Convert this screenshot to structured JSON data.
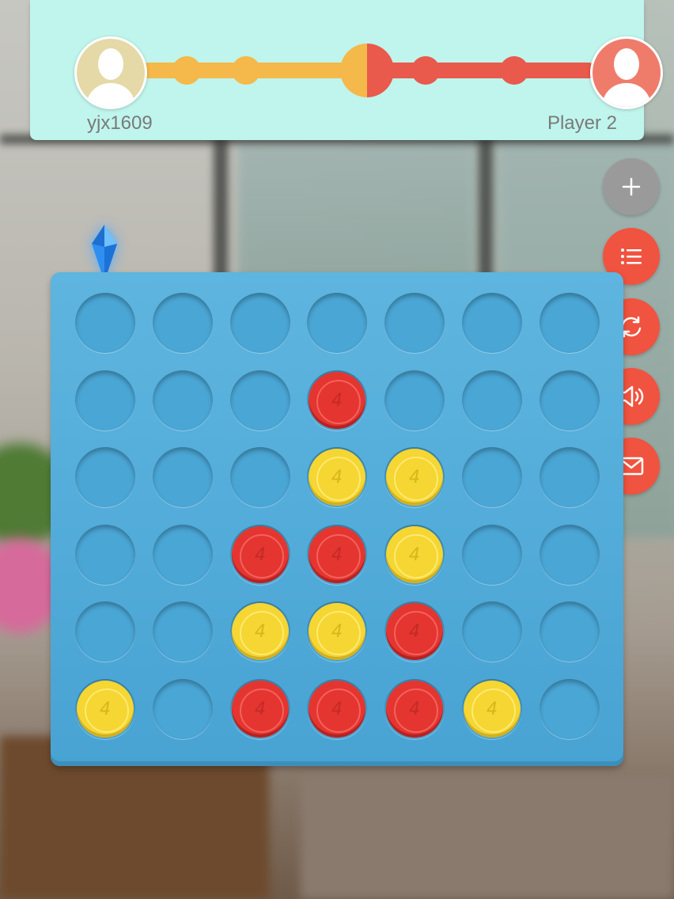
{
  "players": {
    "player1": {
      "name": "yjx1609",
      "color": "#f5b84a"
    },
    "player2": {
      "name": "Player 2",
      "color": "#e9594c"
    }
  },
  "side_buttons": [
    {
      "name": "add-button",
      "icon": "plus-icon",
      "color": "#9a9a9a"
    },
    {
      "name": "menu-button",
      "icon": "list-icon",
      "color": "#f0533f"
    },
    {
      "name": "restart-button",
      "icon": "refresh-icon",
      "color": "#f0533f"
    },
    {
      "name": "sound-button",
      "icon": "speaker-icon",
      "color": "#f0533f"
    },
    {
      "name": "message-button",
      "icon": "mail-icon",
      "color": "#f0533f"
    }
  ],
  "board": {
    "columns": 7,
    "rows": 6,
    "disc_glyph": "4",
    "selected_column": 0,
    "grid": [
      [
        null,
        null,
        null,
        null,
        null,
        null,
        null
      ],
      [
        null,
        null,
        null,
        "red",
        null,
        null,
        null
      ],
      [
        null,
        null,
        null,
        "yellow",
        "yellow",
        null,
        null
      ],
      [
        null,
        null,
        "red",
        "red",
        "yellow",
        null,
        null
      ],
      [
        null,
        null,
        "yellow",
        "yellow",
        "red",
        null,
        null
      ],
      [
        "yellow",
        null,
        "red",
        "red",
        "red",
        "yellow",
        null
      ]
    ]
  }
}
